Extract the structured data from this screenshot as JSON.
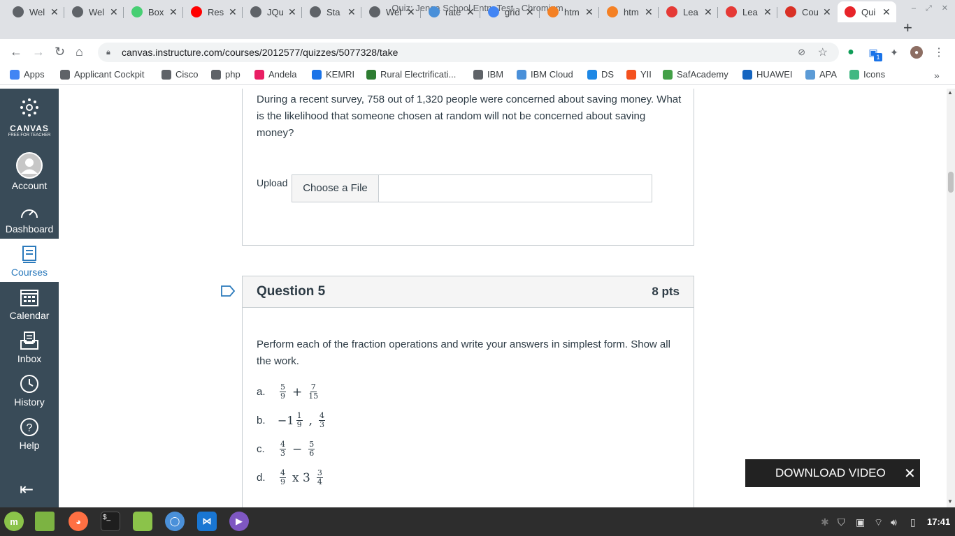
{
  "window": {
    "title": "Quiz: Jenga School Entry Test - Chromium"
  },
  "tabs": [
    {
      "label": "Wel",
      "icon": "globe-icon",
      "color": "#5f6368"
    },
    {
      "label": "Wel",
      "icon": "globe-icon",
      "color": "#5f6368"
    },
    {
      "label": "Box",
      "icon": "codepen-icon",
      "color": "#47cf73"
    },
    {
      "label": "Res",
      "icon": "youtube-icon",
      "color": "#ff0000"
    },
    {
      "label": "JQu",
      "icon": "globe-icon",
      "color": "#5f6368"
    },
    {
      "label": "Sta",
      "icon": "globe-icon",
      "color": "#5f6368"
    },
    {
      "label": "Wel",
      "icon": "globe-icon",
      "color": "#5f6368"
    },
    {
      "label": "rate",
      "icon": "balloon-icon",
      "color": "#4a90d9"
    },
    {
      "label": "grid",
      "icon": "google-icon",
      "color": "#4285f4"
    },
    {
      "label": "htm",
      "icon": "stackoverflow-icon",
      "color": "#f48024"
    },
    {
      "label": "htm",
      "icon": "stackoverflow-icon",
      "color": "#f48024"
    },
    {
      "label": "Lea",
      "icon": "grid-logo-icon",
      "color": "#e53935"
    },
    {
      "label": "Lea",
      "icon": "grid-logo-icon",
      "color": "#e53935"
    },
    {
      "label": "Cou",
      "icon": "gmail-icon",
      "color": "#d93025"
    },
    {
      "label": "Qui",
      "icon": "canvas-icon",
      "color": "#e72429"
    }
  ],
  "toolbar": {
    "url": "canvas.instructure.com/courses/2012577/quizzes/5077328/take",
    "ext_badge": "1"
  },
  "bookmarks": [
    {
      "label": "Apps",
      "icon": "apps-grid-icon",
      "color": "#4285f4"
    },
    {
      "label": "Applicant Cockpit",
      "icon": "globe-icon",
      "color": "#5f6368"
    },
    {
      "label": "Cisco",
      "icon": "globe-icon",
      "color": "#5f6368"
    },
    {
      "label": "php",
      "icon": "globe-icon",
      "color": "#5f6368"
    },
    {
      "label": "Andela",
      "icon": "andela-icon",
      "color": "#e91e63"
    },
    {
      "label": "KEMRI",
      "icon": "kemri-icon",
      "color": "#1a73e8"
    },
    {
      "label": "Rural Electrificati...",
      "icon": "rea-icon",
      "color": "#2e7d32"
    },
    {
      "label": "IBM",
      "icon": "ibm-icon",
      "color": "#5f6368"
    },
    {
      "label": "IBM Cloud",
      "icon": "cloud-icon",
      "color": "#4a90d9"
    },
    {
      "label": "DS",
      "icon": "shield-icon",
      "color": "#1e88e5"
    },
    {
      "label": "YII",
      "icon": "b-icon",
      "color": "#f4511e"
    },
    {
      "label": "SafAcademy",
      "icon": "saf-icon",
      "color": "#43a047"
    },
    {
      "label": "HUAWEI",
      "icon": "huawei-icon",
      "color": "#1565c0"
    },
    {
      "label": "APA",
      "icon": "cloud-icon",
      "color": "#5c9bd6"
    },
    {
      "label": "Icons",
      "icon": "vue-icon",
      "color": "#41b883"
    }
  ],
  "canvas_nav": {
    "logo_title": "CANVAS",
    "logo_sub": "FREE FOR TEACHER",
    "items": [
      {
        "label": "Account"
      },
      {
        "label": "Dashboard"
      },
      {
        "label": "Courses"
      },
      {
        "label": "Calendar"
      },
      {
        "label": "Inbox"
      },
      {
        "label": "History"
      },
      {
        "label": "Help"
      }
    ]
  },
  "question4": {
    "text": "During a recent survey, 758 out of 1,320 people were concerned about saving money. What is the likelihood that someone chosen at random will not be concerned about saving money?",
    "upload_label": "Upload",
    "upload_button": "Choose a File"
  },
  "question5": {
    "title": "Question 5",
    "points": "8 pts",
    "text": "Perform each of the fraction operations and write your answers in simplest form. Show all the work.",
    "parts": [
      {
        "label": "a.",
        "whole": "",
        "n1": "5",
        "d1": "9",
        "op": "+",
        "n2": "7",
        "d2": "15"
      },
      {
        "label": "b.",
        "whole": "−1",
        "n1": "1",
        "d1": "9",
        "op": ",",
        "n2": "4",
        "d2": "3"
      },
      {
        "label": "c.",
        "whole": "",
        "n1": "4",
        "d1": "3",
        "op": "−",
        "n2": "5",
        "d2": "6"
      },
      {
        "label": "d.",
        "whole": "",
        "n1": "4",
        "d1": "9",
        "op": "x 3",
        "n2": "3",
        "d2": "4"
      }
    ]
  },
  "download_bar": {
    "label": "DOWNLOAD VIDEO"
  },
  "taskbar": {
    "clock": "17:41"
  }
}
